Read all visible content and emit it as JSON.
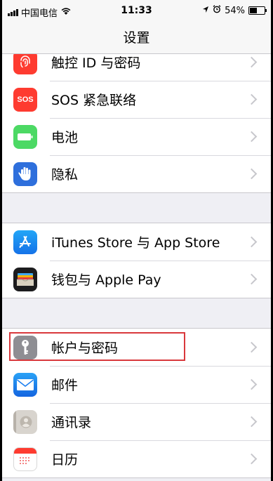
{
  "status_bar": {
    "carrier": "中国电信",
    "time": "11:33",
    "battery_percent": "54%",
    "battery_level": 0.54
  },
  "nav": {
    "title": "设置"
  },
  "groups": [
    {
      "items": [
        {
          "label": "触控 ID 与密码",
          "icon": "fingerprint-icon",
          "color": "#fe3b30"
        },
        {
          "label": "SOS 紧急联络",
          "icon": "sos-icon",
          "color": "#fe3b30",
          "icon_text": "SOS"
        },
        {
          "label": "电池",
          "icon": "battery-icon",
          "color": "#4cd964"
        },
        {
          "label": "隐私",
          "icon": "hand-icon",
          "color": "#2e6fdc"
        }
      ]
    },
    {
      "items": [
        {
          "label": "iTunes Store 与 App Store",
          "icon": "app-store-icon",
          "color": "#1a8cf5"
        },
        {
          "label": "钱包与 Apple Pay",
          "icon": "wallet-icon",
          "color": "#1c1c1e"
        }
      ]
    },
    {
      "items": [
        {
          "label": "帐户与密码",
          "icon": "key-icon",
          "color": "#8e8e93",
          "highlighted": true
        },
        {
          "label": "邮件",
          "icon": "mail-icon",
          "color": "#1a82f0"
        },
        {
          "label": "通讯录",
          "icon": "contacts-icon",
          "color": "#c9c5bf"
        },
        {
          "label": "日历",
          "icon": "calendar-icon",
          "color": "#ffffff"
        }
      ]
    }
  ]
}
